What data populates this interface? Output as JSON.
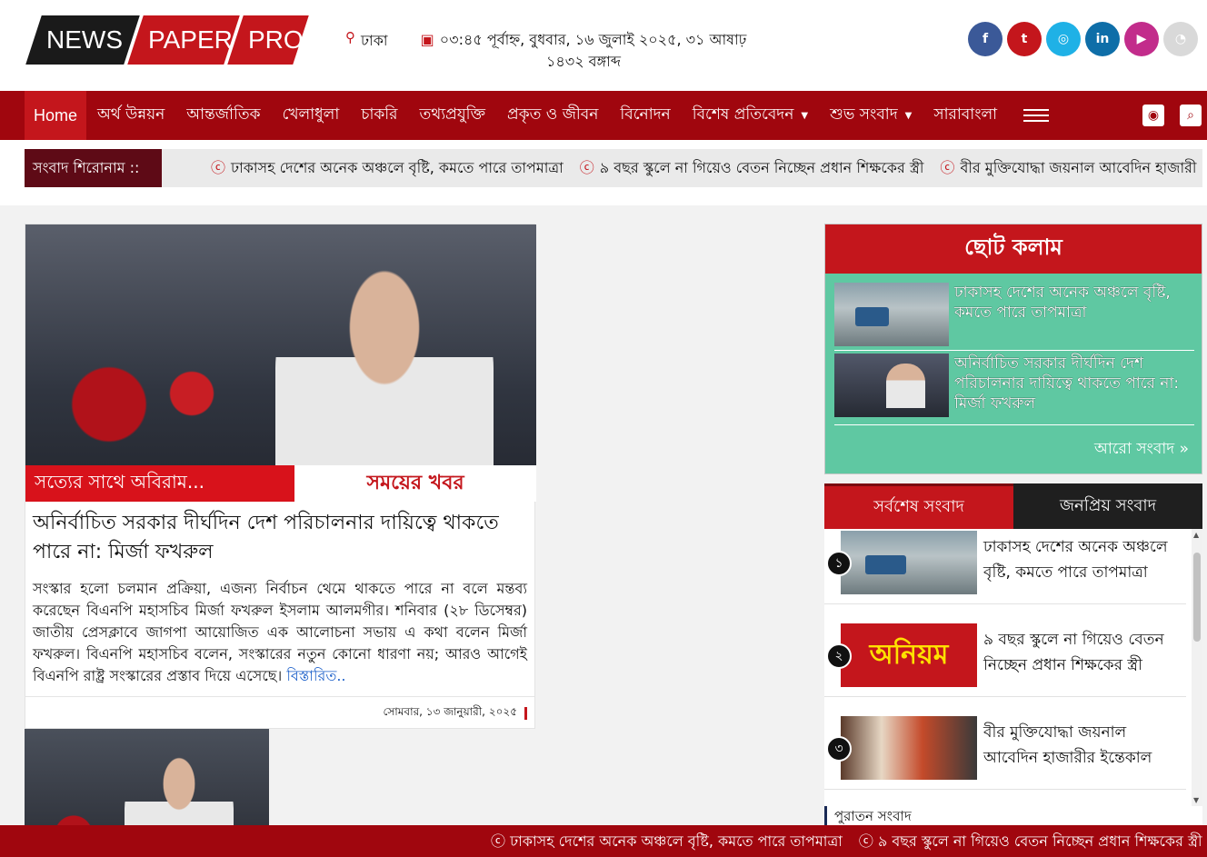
{
  "header": {
    "logo": {
      "part1": "NEWS",
      "part2": "PAPER",
      "part3": "PRO"
    },
    "location": "ঢাকা",
    "datetime_line1": "০৩:৪৫ পূর্বাহ্ন, বুধবার, ১৬ জুলাই ২০২৫, ৩১ আষাঢ়",
    "datetime_line2": "১৪৩২ বঙ্গাব্দ",
    "social": [
      {
        "icon": "facebook-icon",
        "glyph": "f",
        "color": "#3b5998"
      },
      {
        "icon": "twitter-icon",
        "glyph": "t",
        "color": "#c4161c"
      },
      {
        "icon": "instagram-icon",
        "glyph": "◎",
        "color": "#1fb1e6"
      },
      {
        "icon": "linkedin-icon",
        "glyph": "in",
        "color": "#0e6ea8"
      },
      {
        "icon": "youtube-icon",
        "glyph": "▶",
        "color": "#c22c8b"
      },
      {
        "icon": "rss-icon",
        "glyph": "◔",
        "color": "#d9d9d9"
      }
    ]
  },
  "nav": {
    "items": [
      {
        "label": "Home"
      },
      {
        "label": "অর্থ উন্নয়ন"
      },
      {
        "label": "আন্তর্জাতিক"
      },
      {
        "label": "খেলাধুলা"
      },
      {
        "label": "চাকরি"
      },
      {
        "label": "তথ্যপ্রযুক্তি"
      },
      {
        "label": "প্রকৃত ও জীবন"
      },
      {
        "label": "বিনোদন"
      },
      {
        "label": "বিশেষ প্রতিবেদন",
        "dropdown": true
      },
      {
        "label": "শুভ সংবাদ",
        "dropdown": true
      },
      {
        "label": "সারাবাংলা"
      }
    ],
    "icons": [
      "menu-icon",
      "user-icon",
      "search-icon"
    ]
  },
  "ticker": {
    "label": "সংবাদ শিরোনাম ::",
    "items": [
      "ঢাকাসহ দেশের অনেক অঞ্চলে বৃষ্টি, কমতে পারে তাপমাত্রা",
      "৯ বছর স্কুলে না গিয়েও বেতন নিচ্ছেন প্রধান শিক্ষকের স্ত্রী",
      "বীর মুক্তিযোদ্ধা জয়নাল আবেদিন হাজারী"
    ]
  },
  "lead": {
    "image_band_left": "সত্যের সাথে অবিরাম...",
    "image_band_right": "সময়ের খবর",
    "headline": "অনির্বাচিত সরকার দীর্ঘদিন দেশ পরিচালনার দায়িত্বে থাকতে পারে না: মির্জা ফখরুল",
    "summary": "সংস্কার হলো চলমান প্রক্রিয়া, এজন্য নির্বাচন থেমে থাকতে পারে না বলে মন্তব্য করেছেন বিএনপি মহাসচিব মির্জা ফখরুল ইসলাম আলমগীর। শনিবার (২৮ ডিসেম্বর) জাতীয় প্রেসক্লাবে জাগপা আয়োজিত এক আলোচনা সভায় এ কথা বলেন মির্জা ফখরুল। বিএনপি মহাসচিব বলেন, সংস্কারের নতুন কোনো ধারণা নয়; আরও আগেই বিএনপি রাষ্ট্র সংস্কারের প্রস্তাব দিয়ে এসেছে।",
    "more": "বিস্তারিত..",
    "date": "সোমবার, ১৩ জানুয়ারী, ২০২৫"
  },
  "short_column": {
    "title": "ছোট কলাম",
    "items": [
      {
        "title": "ঢাকাসহ দেশের অনেক অঞ্চলে বৃষ্টি, কমতে পারে তাপমাত্রা"
      },
      {
        "title": "অনির্বাচিত সরকার দীর্ঘদিন দেশ পরিচালনার দায়িত্বে থাকতে পারে না: মির্জা ফখরুল"
      }
    ],
    "more": "আরো সংবাদ »"
  },
  "tabs": {
    "latest": "সর্বশেষ সংবাদ",
    "popular": "জনপ্রিয় সংবাদ",
    "items": [
      {
        "num": "১",
        "title": "ঢাকাসহ দেশের অনেক অঞ্চলে বৃষ্টি, কমতে পারে তাপমাত্রা"
      },
      {
        "num": "২",
        "title": "৯ বছর স্কুলে না গিয়েও বেতন নিচ্ছেন প্রধান শিক্ষকের স্ত্রী",
        "image_text": "অনিয়ম"
      },
      {
        "num": "৩",
        "title": "বীর মুক্তিযোদ্ধা জয়নাল আবেদিন হাজারীর ইন্তেকাল"
      }
    ]
  },
  "archive": {
    "title": "পুরাতন সংবাদ"
  },
  "bottom_ticker": [
    "ঢাকাসহ দেশের অনেক অঞ্চলে বৃষ্টি, কমতে পারে তাপমাত্রা",
    "৯ বছর স্কুলে না গিয়েও বেতন নিচ্ছেন প্রধান শিক্ষকের স্ত্রী"
  ],
  "colors": {
    "brand_red": "#c4161c",
    "nav_red": "#a0060e",
    "ticker_label": "#5e0a16",
    "side_green": "#5fc8a2"
  }
}
